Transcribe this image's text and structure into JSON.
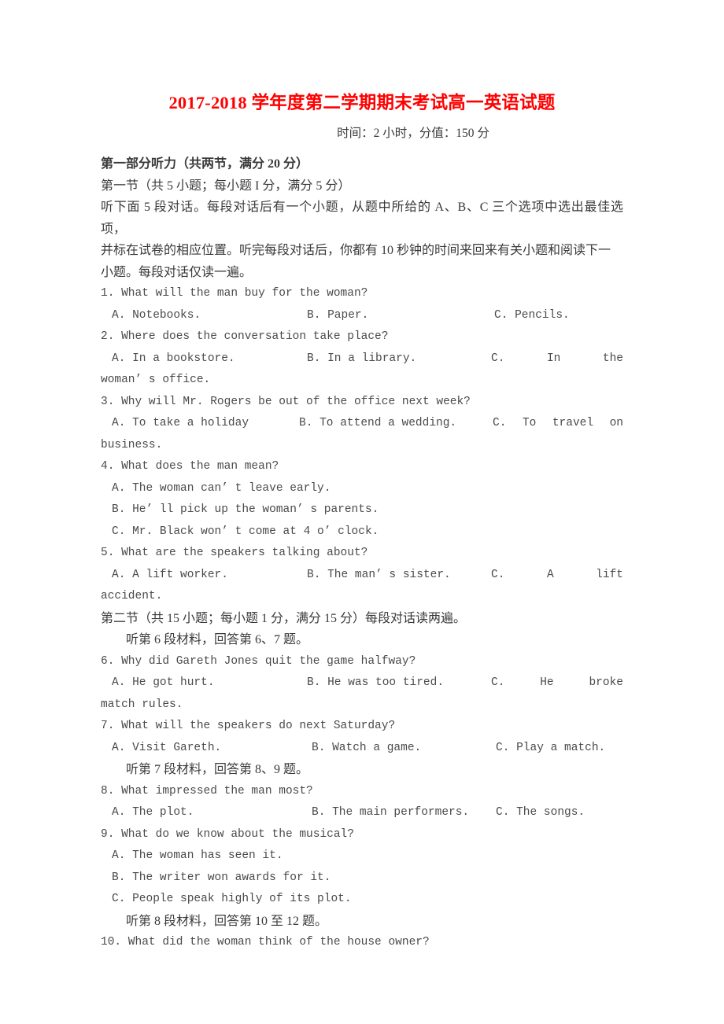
{
  "document": {
    "title": "2017-2018 学年度第二学期期末考试高一英语试题",
    "subtitle": "时间：2 小时，分值：150 分",
    "title_color": "#ff0000",
    "body_color": "#3a3a3a"
  },
  "part1": {
    "heading": "第一部分听力（共两节，满分 20 分）",
    "section1_heading": "第一节（共 5 小题；每小题 I 分，满分 5 分）",
    "section1_instructions_line1": "听下面 5 段对话。每段对话后有一个小题，从题中所给的 A、B、C 三个选项中选出最佳选项，",
    "section1_instructions_line2": "并标在试卷的相应位置。听完每段对话后，你都有 10 秒钟的时间来回来有关小题和阅读下一",
    "section1_instructions_line3": "小题。每段对话仅读一遍。",
    "section2_heading": "第二节（共 15 小题；每小题 1 分，满分 15 分）每段对话读两遍。"
  },
  "material_prompts": {
    "m6": "听第 6 段材料，回答第 6、7 题。",
    "m7": "听第 7 段材料，回答第 8、9 题。",
    "m8": "听第 8 段材料，回答第 10 至 12 题。"
  },
  "questions": [
    {
      "number": "1.",
      "text": "1. What will the man buy for the woman?",
      "options": {
        "a": "A. Notebooks.",
        "b": "B. Paper.",
        "c": "C. Pencils."
      }
    },
    {
      "number": "2.",
      "text": "2. Where does the conversation take place?",
      "options": {
        "a": "A. In a bookstore.",
        "b": "B. In a library.",
        "c_1": "C.",
        "c_2": "In",
        "c_3": "the",
        "continuation": "woman’ s office."
      }
    },
    {
      "number": "3.",
      "text": "3. Why will Mr. Rogers be out of the office next week?",
      "options": {
        "a": "A. To take a holiday",
        "b": "B. To attend a wedding.",
        "c_1": "C.",
        "c_2": "To",
        "c_3": "travel",
        "c_4": "on",
        "continuation": "business."
      }
    },
    {
      "number": "4.",
      "text": "4. What does the man mean?",
      "options": {
        "a": "A. The woman can’ t leave early.",
        "b": "B. He’ ll pick up the woman’ s parents.",
        "c": "C. Mr. Black won’ t come at 4 o’ clock."
      }
    },
    {
      "number": "5.",
      "text": "5. What are the speakers talking about?",
      "options": {
        "a": "A. A lift worker.",
        "b": "B. The man’ s sister.",
        "c_1": "C.",
        "c_2": "A",
        "c_3": "lift",
        "continuation": "accident."
      }
    },
    {
      "number": "6.",
      "text": "6. Why did Gareth Jones quit the game halfway?",
      "options": {
        "a": "A. He got hurt.",
        "b": "B. He was too tired.",
        "c_1": "C.",
        "c_2": "He",
        "c_3": "broke",
        "continuation": "match rules."
      }
    },
    {
      "number": "7.",
      "text": "7. What will the speakers do next Saturday?",
      "options": {
        "a": "A. Visit Gareth.",
        "b": "B. Watch a game.",
        "c": "C. Play a match."
      }
    },
    {
      "number": "8.",
      "text": "8. What impressed the man most?",
      "options": {
        "a": "A. The plot.",
        "b": "B. The main performers.",
        "c": "C. The songs."
      }
    },
    {
      "number": "9.",
      "text": "9. What do we know about the musical?",
      "options": {
        "a": "A. The woman has seen it.",
        "b": "B. The writer won awards for it.",
        "c": "C. People speak highly of its plot."
      }
    },
    {
      "number": "10.",
      "text": "10. What did the woman think of the house owner?",
      "options": {}
    }
  ]
}
